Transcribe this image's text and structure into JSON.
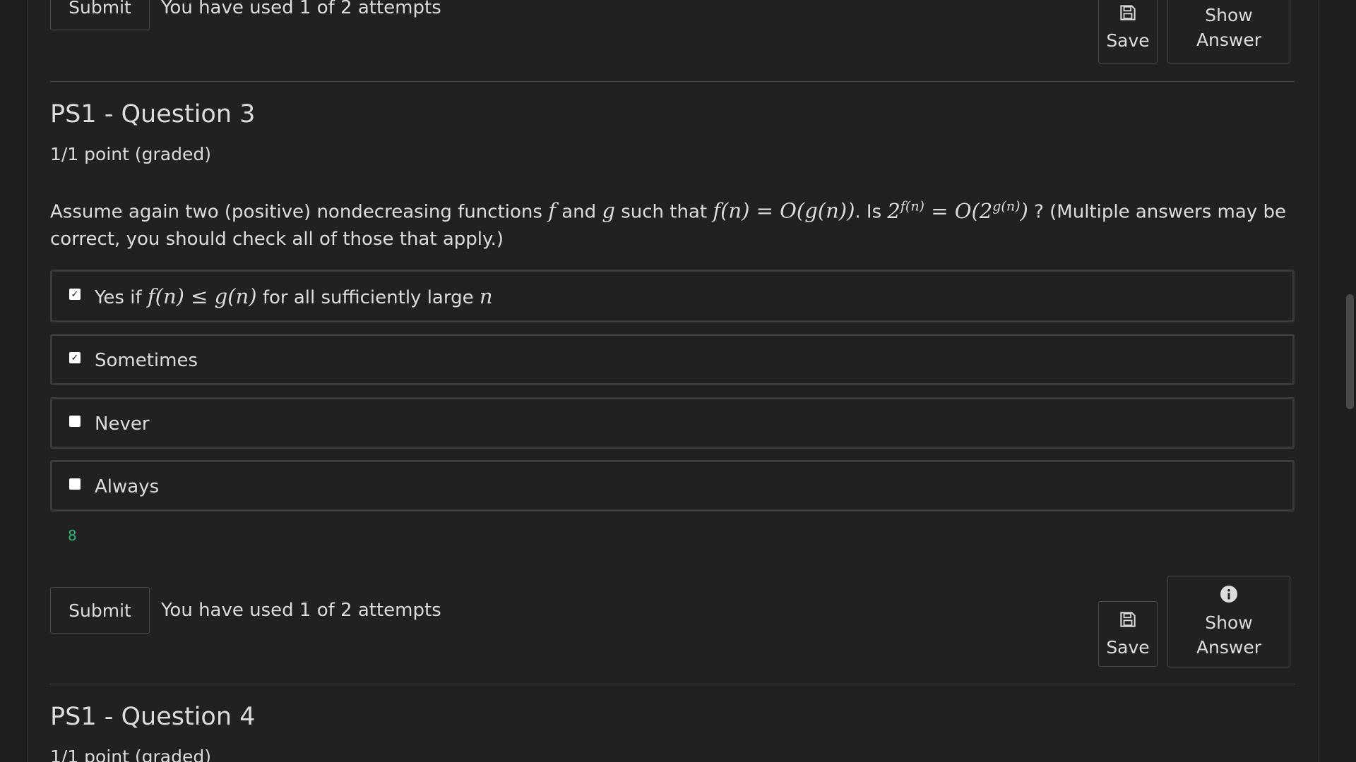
{
  "top_controls": {
    "submit_label": "Submit",
    "attempts_text": "You have used 1 of 2 attempts",
    "save_label": "Save",
    "show_answer_label": "Show Answer"
  },
  "question3": {
    "title": "PS1 - Question 3",
    "points": "1/1 point (graded)",
    "prompt_part1": "Assume again two (positive) nondecreasing functions",
    "var_f": "f",
    "and_text": "and",
    "var_g": "g",
    "such_that": "such that",
    "condition_math": "f(n) = O(g(n))",
    "is_text": ". Is",
    "question_math_base": "2",
    "question_math_exp1": "f(n)",
    "question_math_mid": " = O(2",
    "question_math_exp2": "g(n)",
    "question_math_end": ")",
    "prompt_part2": "? (Multiple answers may be correct, you should check all of those that apply.)",
    "choices": [
      {
        "label_prefix": "Yes if",
        "math": "f(n) ≤ g(n)",
        "label_suffix": "for all sufficiently large",
        "math2": "n",
        "checked": true
      },
      {
        "label": "Sometimes",
        "checked": true
      },
      {
        "label": "Never",
        "checked": false
      },
      {
        "label": "Always",
        "checked": false
      }
    ],
    "hint_number": "8",
    "submit_label": "Submit",
    "attempts_text": "You have used 1 of 2 attempts",
    "save_label": "Save",
    "show_answer_label": "Show Answer"
  },
  "question4": {
    "title": "PS1 - Question 4",
    "points": "1/1 point (graded)"
  },
  "icons": {
    "save": "floppy-disk-icon",
    "info": "info-circle-icon",
    "checkmark": "check-icon"
  },
  "colors": {
    "background": "#1e1e1e",
    "panel": "#212121",
    "text": "#dcdcdc",
    "accent_green": "#2bb673",
    "border": "#4a4a4a"
  }
}
